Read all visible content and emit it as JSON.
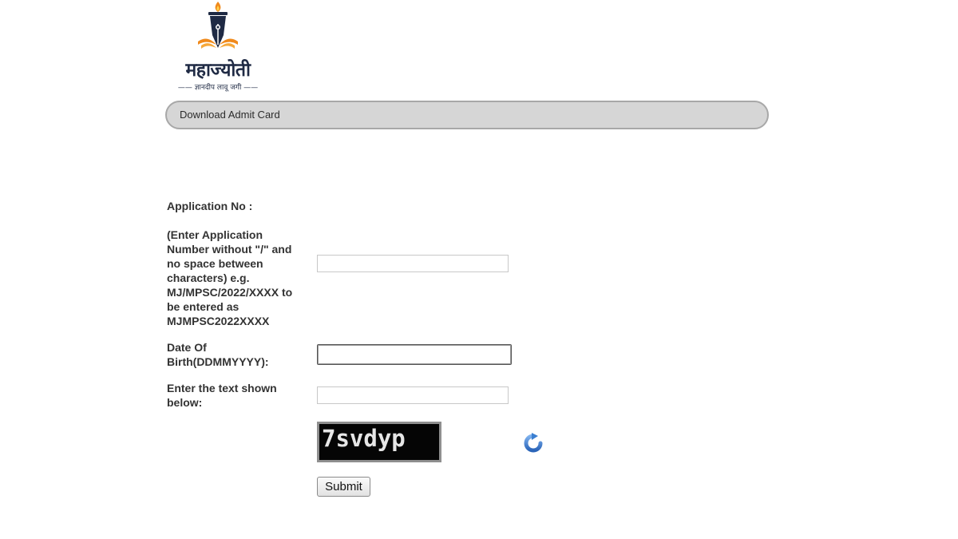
{
  "logo": {
    "title": "महाज्योती",
    "tagline": "ज्ञानदीप लावू जगी"
  },
  "header": {
    "title": "Download Admit Card"
  },
  "form": {
    "application_label": "Application No :",
    "application_hint": "(Enter Application Number without \"/\" and no space between characters) e.g. MJ/MPSC/2022/XXXX to be entered as MJMPSC2022XXXX",
    "application_value": "",
    "dob_label": "Date Of Birth(DDMMYYYY):",
    "dob_value": "",
    "captcha_label": "Enter the text shown below:",
    "captcha_value": "",
    "captcha_text": "7svdyp",
    "refresh_icon": "refresh-icon",
    "submit_label": "Submit"
  },
  "colors": {
    "header_bg": "#d6d6d6",
    "captcha_bg": "#050505",
    "refresh_icon": "#3b7fd1"
  }
}
